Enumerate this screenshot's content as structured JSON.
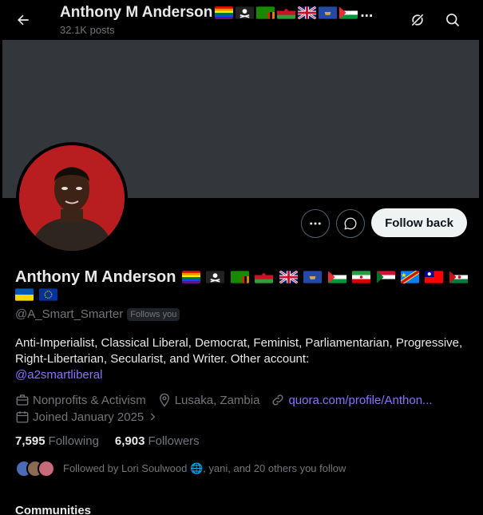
{
  "topbar": {
    "name": "Anthony M Anderson",
    "ellipsis": "...",
    "posts": "32.1K posts",
    "flags": [
      "rainbow-flag",
      "pirate-flag",
      "zambia-flag",
      "malawi-flag",
      "uk-flag",
      "kosovo-flag",
      "palestine-flag"
    ]
  },
  "profile": {
    "name": "Anthony M Anderson",
    "flags_line1": [
      "rainbow-flag",
      "pirate-flag",
      "zambia-flag",
      "malawi-flag",
      "uk-flag",
      "kosovo-flag",
      "palestine-flag",
      "iran-flag",
      "sudan-flag",
      "drc-flag",
      "taiwan-flag",
      "western-sahara-flag"
    ],
    "flags_line2": [
      "ukraine-flag",
      "eu-flag"
    ],
    "handle": "@A_Smart_Smarter",
    "follows_you": "Follows you",
    "bio_text": "Anti-Imperialist, Classical Liberal, Democrat, Feminist, Parliamentarian, Progressive, Right-Libertarian, Secularist, and Writer. Other account:",
    "bio_link": "@a2smartliberal",
    "category": "Nonprofits & Activism",
    "location": "Lusaka, Zambia",
    "website": "quora.com/profile/Anthon...",
    "joined": "Joined January 2025",
    "following_count": "7,595",
    "following_label": "Following",
    "followers_count": "6,903",
    "followers_label": "Followers",
    "followed_by": "Followed by Lori Soulwood 🌐, yani, and 20 others you follow"
  },
  "buttons": {
    "more": "More",
    "message": "Message",
    "follow_back": "Follow back"
  },
  "section_heading": "Communities",
  "colors": {
    "background": "#000000",
    "banner": "#33363a",
    "avatar_bg": "#b81d1f",
    "link": "#8a73ff",
    "muted": "#71767b",
    "text": "#e7e9ea",
    "follow_button_bg": "#eff3f4"
  }
}
